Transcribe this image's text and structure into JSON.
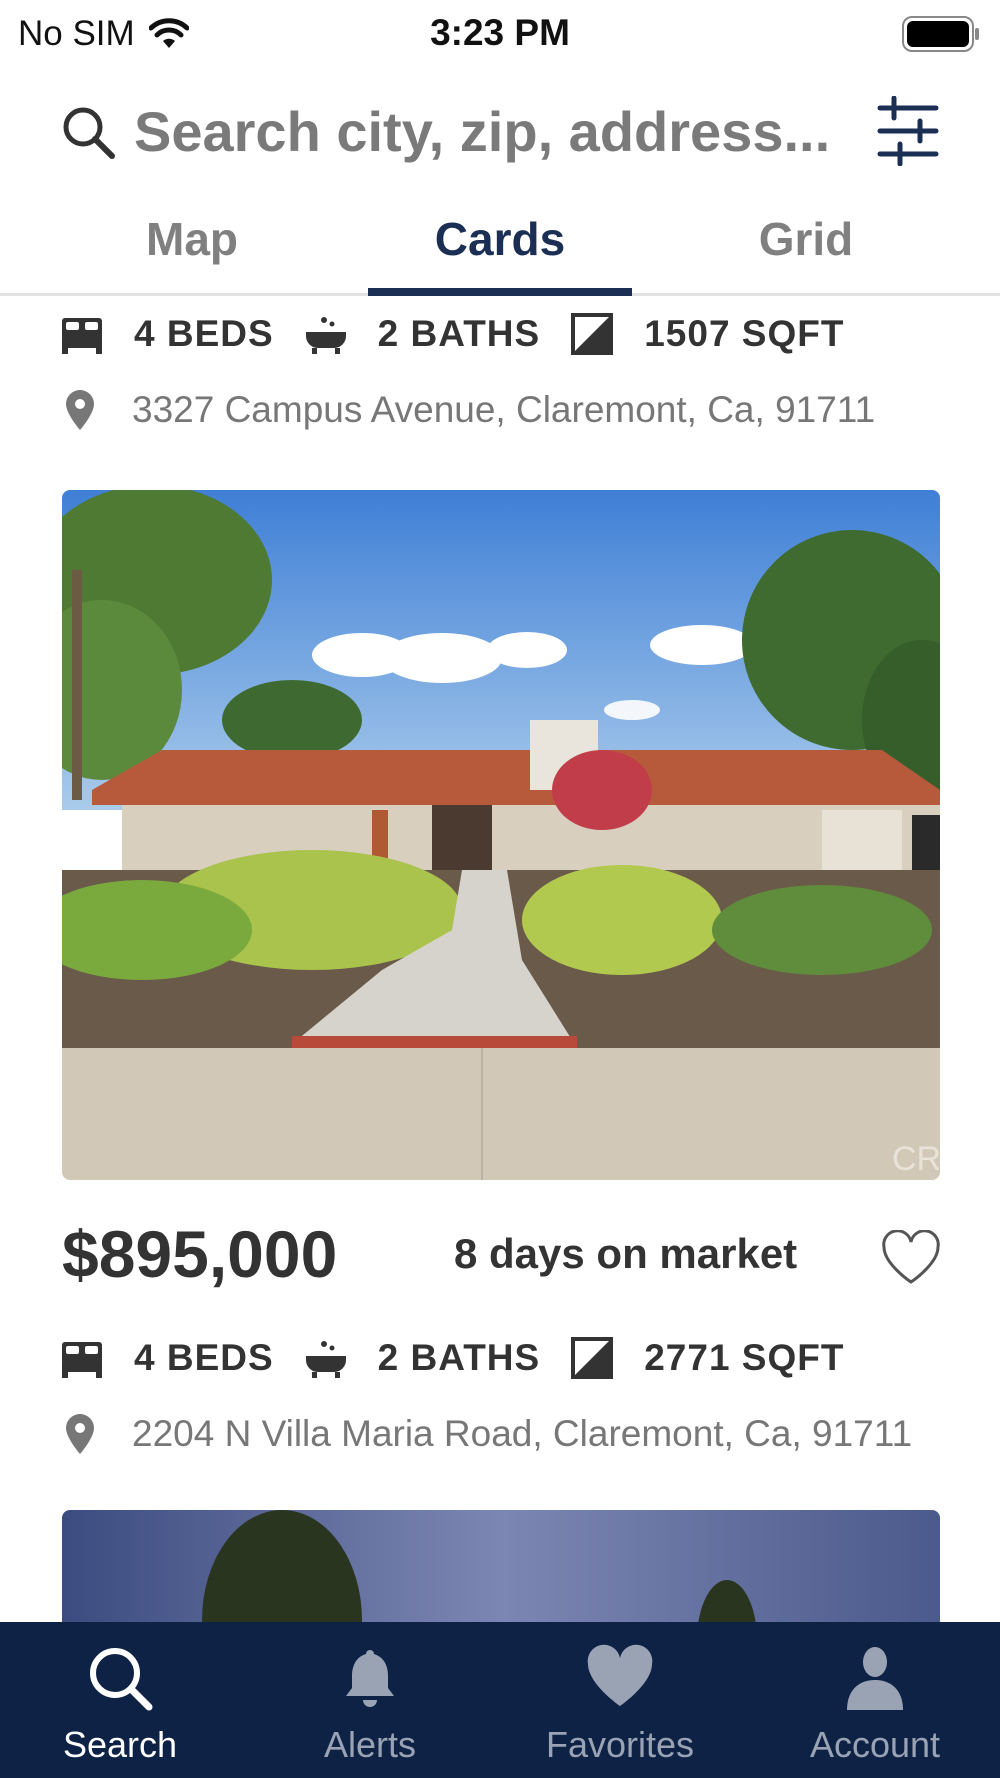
{
  "status_bar": {
    "carrier": "No SIM",
    "time": "3:23 PM"
  },
  "search": {
    "placeholder": "Search city, zip, address..."
  },
  "tabs": [
    {
      "label": "Map"
    },
    {
      "label": "Cards",
      "active": true
    },
    {
      "label": "Grid"
    }
  ],
  "listings": [
    {
      "beds": "4 BEDS",
      "baths": "2 BATHS",
      "sqft": "1507 SQFT",
      "address": "3327 Campus Avenue, Claremont, Ca, 91711"
    },
    {
      "photo_watermark": "CR",
      "price": "$895,000",
      "days_on_market": "8 days on market",
      "favorited": false,
      "beds": "4 BEDS",
      "baths": "2 BATHS",
      "sqft": "2771 SQFT",
      "address": "2204 N Villa Maria Road, Claremont, Ca, 91711"
    }
  ],
  "bottom_nav": [
    {
      "label": "Search",
      "icon": "search-icon",
      "active": true
    },
    {
      "label": "Alerts",
      "icon": "bell-icon"
    },
    {
      "label": "Favorites",
      "icon": "heart-icon"
    },
    {
      "label": "Account",
      "icon": "person-icon"
    }
  ],
  "colors": {
    "brand_navy": "#0e2246",
    "tab_active": "#1b2f55",
    "muted_text": "#777777"
  }
}
